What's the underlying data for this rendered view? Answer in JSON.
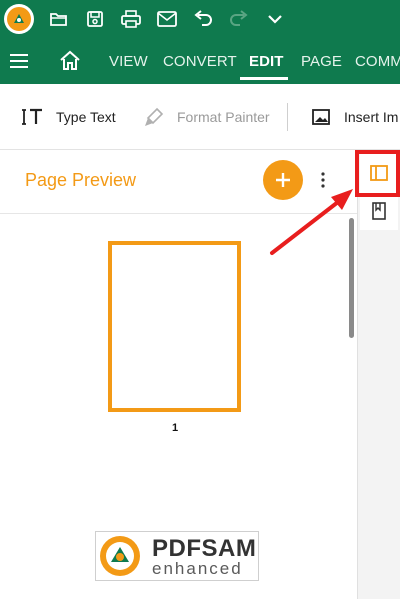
{
  "menu": {
    "tabs": [
      {
        "label": "VIEW"
      },
      {
        "label": "CONVERT"
      },
      {
        "label": "EDIT"
      },
      {
        "label": "PAGE"
      },
      {
        "label": "COMM"
      }
    ]
  },
  "toolbar": {
    "type_text_label": "Type Text",
    "format_painter_label": "Format Painter",
    "insert_image_label": "Insert Im"
  },
  "panel": {
    "title": "Page Preview",
    "page_number": "1"
  },
  "branding": {
    "logo_top": "PDFSAM",
    "logo_bottom": "enhanced"
  },
  "icons": {
    "app": "app-logo-icon",
    "quick_access": [
      "open-folder-icon",
      "save-icon",
      "print-icon",
      "mail-icon",
      "undo-icon",
      "redo-icon",
      "chevron-down-icon"
    ],
    "menu": "hamburger-icon",
    "home": "home-icon",
    "add": "plus-icon",
    "more": "more-vertical-icon",
    "rail": [
      "page-preview-panel-icon",
      "bookmark-icon"
    ]
  },
  "colors": {
    "brand_green": "#0f7a4e",
    "accent_orange": "#f39a16",
    "annotation_red": "#e81e1e"
  }
}
